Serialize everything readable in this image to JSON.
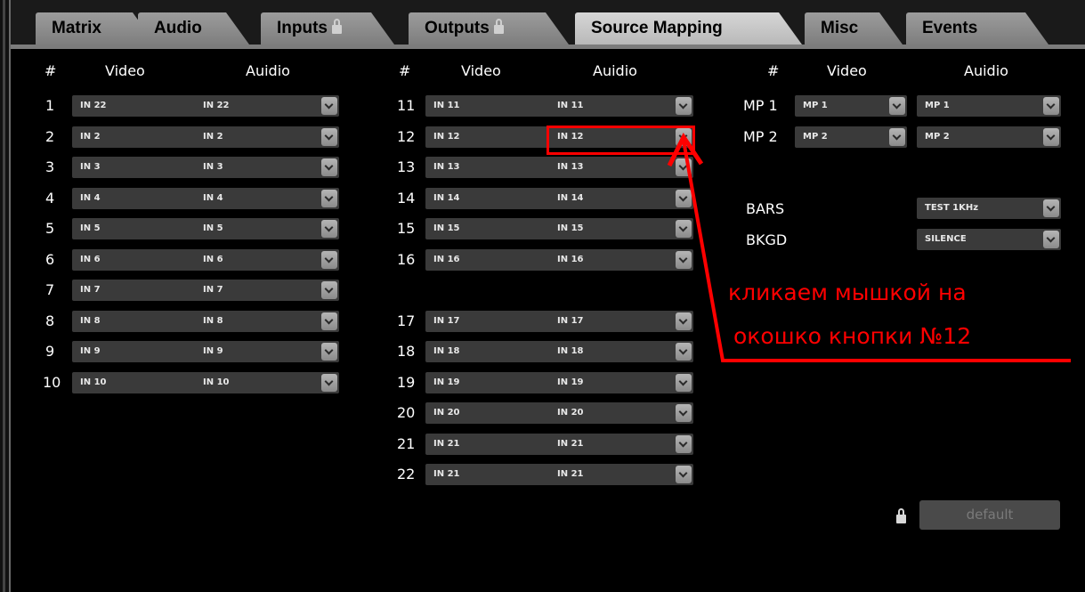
{
  "tabs": [
    {
      "label": "Matrix",
      "locked": false,
      "active": false
    },
    {
      "label": "Audio",
      "locked": false,
      "active": false
    },
    {
      "label": "Inputs",
      "locked": true,
      "active": false
    },
    {
      "label": "Outputs",
      "locked": true,
      "active": false
    },
    {
      "label": "Source Mapping",
      "locked": false,
      "active": true
    },
    {
      "label": "Misc",
      "locked": false,
      "active": false
    },
    {
      "label": "Events",
      "locked": false,
      "active": false
    }
  ],
  "headers": {
    "hash": "#",
    "video": "Video",
    "audio": "Auidio"
  },
  "col1": [
    {
      "num": "1",
      "video": "IN 22",
      "audio": "IN 22"
    },
    {
      "num": "2",
      "video": "IN 2",
      "audio": "IN 2"
    },
    {
      "num": "3",
      "video": "IN 3",
      "audio": "IN 3"
    },
    {
      "num": "4",
      "video": "IN 4",
      "audio": "IN 4"
    },
    {
      "num": "5",
      "video": "IN 5",
      "audio": "IN 5"
    },
    {
      "num": "6",
      "video": "IN 6",
      "audio": "IN 6"
    },
    {
      "num": "7",
      "video": "IN 7",
      "audio": "IN 7"
    },
    {
      "num": "8",
      "video": "IN 8",
      "audio": "IN 8"
    },
    {
      "num": "9",
      "video": "IN 9",
      "audio": "IN 9"
    },
    {
      "num": "10",
      "video": "IN 10",
      "audio": "IN 10"
    }
  ],
  "col2": [
    {
      "num": "11",
      "video": "IN 11",
      "audio": "IN 11"
    },
    {
      "num": "12",
      "video": "IN 12",
      "audio": "IN 12"
    },
    {
      "num": "13",
      "video": "IN 13",
      "audio": "IN 13"
    },
    {
      "num": "14",
      "video": "IN 14",
      "audio": "IN 14"
    },
    {
      "num": "15",
      "video": "IN 15",
      "audio": "IN 15"
    },
    {
      "num": "16",
      "video": "IN 16",
      "audio": "IN 16"
    },
    {
      "num": "17",
      "video": "IN 17",
      "audio": "IN 17"
    },
    {
      "num": "18",
      "video": "IN 18",
      "audio": "IN 18"
    },
    {
      "num": "19",
      "video": "IN 19",
      "audio": "IN 19"
    },
    {
      "num": "20",
      "video": "IN 20",
      "audio": "IN 20"
    },
    {
      "num": "21",
      "video": "IN 21",
      "audio": "IN 21"
    },
    {
      "num": "22",
      "video": "IN 21",
      "audio": "IN 21"
    }
  ],
  "col3": [
    {
      "num": "MP 1",
      "video": "MP 1",
      "audio": "MP 1"
    },
    {
      "num": "MP 2",
      "video": "MP 2",
      "audio": "MP 2"
    }
  ],
  "extras": [
    {
      "label": "BARS",
      "value": "TEST 1KHz"
    },
    {
      "label": "BKGD",
      "value": "SILENCE"
    }
  ],
  "annotation": {
    "line1": "кликаем мышкой на",
    "line2": "окошко кнопки №12",
    "color": "#ff0000"
  },
  "default_button": "default"
}
